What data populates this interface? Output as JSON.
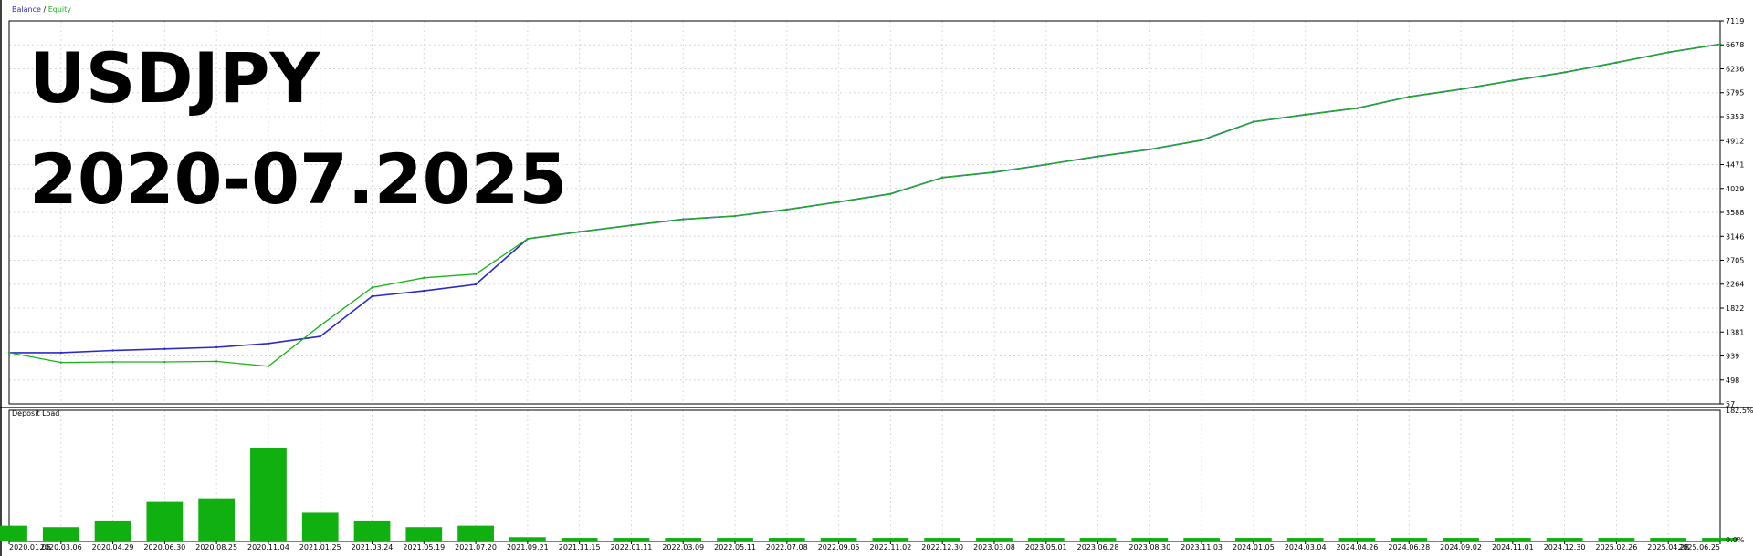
{
  "overlay": {
    "title_line1": "USDJPY",
    "title_line2": "2020-07.2025"
  },
  "legend": {
    "balance_label": "Balance",
    "separator": " / ",
    "equity_label": "Equity"
  },
  "colors": {
    "balance": "#2b2bc8",
    "equity": "#18b418",
    "deposit_load": "#11b011",
    "grid": "#d8d8d8",
    "frame": "#000000"
  },
  "chart_data": [
    {
      "type": "line",
      "title": "",
      "legend": [
        "Balance",
        "Equity"
      ],
      "legend_placement": "top-left",
      "grid": true,
      "y_tick_labels": [
        "7119",
        "6678",
        "6236",
        "5795",
        "5353",
        "4912",
        "4471",
        "4029",
        "3588",
        "3146",
        "2705",
        "2264",
        "1822",
        "1381",
        "939",
        "498",
        "57"
      ],
      "ylim": [
        57,
        7119
      ],
      "x_tick_labels": [
        "2020.01.06",
        "2020.03.06",
        "2020.04.29",
        "2020.06.30",
        "2020.08.25",
        "2020.11.04",
        "2021.01.25",
        "2021.03.24",
        "2021.05.19",
        "2021.07.20",
        "2021.09.21",
        "2021.11.15",
        "2022.01.11",
        "2022.03.09",
        "2022.05.11",
        "2022.07.08",
        "2022.09.05",
        "2022.11.02",
        "2022.12.30",
        "2023.03.08",
        "2023.05.01",
        "2023.06.28",
        "2023.08.30",
        "2023.11.03",
        "2024.01.05",
        "2024.03.04",
        "2024.04.26",
        "2024.06.28",
        "2024.09.02",
        "2024.11.01",
        "2024.12.30",
        "2025.02.26",
        "2025.04.28",
        "2025.06.25"
      ],
      "series": [
        {
          "name": "Balance",
          "x": [
            "2020.01.06",
            "2020.03.06",
            "2020.04.29",
            "2020.06.30",
            "2020.08.25",
            "2020.11.04",
            "2021.01.25",
            "2021.03.24",
            "2021.05.19",
            "2021.07.20",
            "2021.09.21",
            "2021.11.15",
            "2022.01.11",
            "2022.03.09",
            "2022.05.11",
            "2022.07.08",
            "2022.09.05",
            "2022.11.02",
            "2022.12.30",
            "2023.03.08",
            "2023.05.01",
            "2023.06.28",
            "2023.08.30",
            "2023.11.03",
            "2024.01.05",
            "2024.03.04",
            "2024.04.26",
            "2024.06.28",
            "2024.09.02",
            "2024.11.01",
            "2024.12.30",
            "2025.02.26",
            "2025.04.28",
            "2025.06.25"
          ],
          "values": [
            1000,
            1000,
            1040,
            1070,
            1100,
            1170,
            1300,
            2040,
            2140,
            2260,
            3100,
            3230,
            3350,
            3460,
            3520,
            3640,
            3780,
            3930,
            4230,
            4330,
            4470,
            4620,
            4750,
            4920,
            5260,
            5390,
            5510,
            5720,
            5860,
            6020,
            6170,
            6350,
            6540,
            6690
          ]
        },
        {
          "name": "Equity",
          "x": [
            "2020.01.06",
            "2020.03.06",
            "2020.04.29",
            "2020.06.30",
            "2020.08.25",
            "2020.11.04",
            "2021.01.25",
            "2021.03.24",
            "2021.05.19",
            "2021.07.20",
            "2021.09.21",
            "2021.11.15",
            "2022.01.11",
            "2022.03.09",
            "2022.05.11",
            "2022.07.08",
            "2022.09.05",
            "2022.11.02",
            "2022.12.30",
            "2023.03.08",
            "2023.05.01",
            "2023.06.28",
            "2023.08.30",
            "2023.11.03",
            "2024.01.05",
            "2024.03.04",
            "2024.04.26",
            "2024.06.28",
            "2024.09.02",
            "2024.11.01",
            "2024.12.30",
            "2025.02.26",
            "2025.04.28",
            "2025.06.25"
          ],
          "values": [
            1000,
            820,
            830,
            830,
            840,
            750,
            1500,
            2200,
            2380,
            2450,
            3100,
            3230,
            3350,
            3460,
            3520,
            3640,
            3780,
            3930,
            4230,
            4330,
            4470,
            4620,
            4750,
            4920,
            5260,
            5390,
            5510,
            5720,
            5860,
            6020,
            6170,
            6350,
            6540,
            6690
          ]
        }
      ]
    },
    {
      "type": "bar",
      "title": "Deposit Load",
      "y_tick_labels": [
        "182.5%",
        "0.0%"
      ],
      "ylim": [
        0,
        182.5
      ],
      "x_tick_labels": [
        "2020.01.06",
        "2020.03.06",
        "2020.04.29",
        "2020.06.30",
        "2020.08.25",
        "2020.11.04",
        "2021.01.25",
        "2021.03.24",
        "2021.05.19",
        "2021.07.20",
        "2021.09.21",
        "2021.11.15",
        "2022.01.11",
        "2022.03.09",
        "2022.05.11",
        "2022.07.08",
        "2022.09.05",
        "2022.11.02",
        "2022.12.30",
        "2023.03.08",
        "2023.05.01",
        "2023.06.28",
        "2023.08.30",
        "2023.11.03",
        "2024.01.05",
        "2024.03.04",
        "2024.04.26",
        "2024.06.28",
        "2024.09.02",
        "2024.11.01",
        "2024.12.30",
        "2025.02.26",
        "2025.04.28",
        "2025.06.25"
      ],
      "values": [
        22,
        20,
        28,
        55,
        60,
        130,
        40,
        28,
        20,
        22,
        6,
        5,
        5,
        5,
        5,
        5,
        5,
        5,
        5,
        5,
        5,
        5,
        5,
        5,
        5,
        5,
        5,
        5,
        5,
        5,
        5,
        5,
        5,
        5
      ]
    }
  ]
}
